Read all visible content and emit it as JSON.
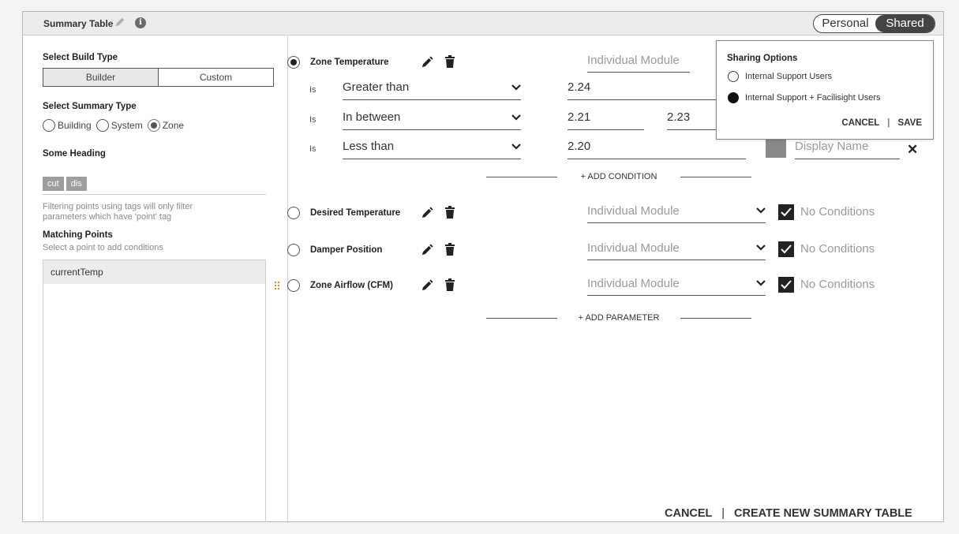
{
  "header": {
    "title": "Summary Table",
    "toggle": {
      "personal_label": "Personal",
      "shared_label": "Shared",
      "selected": "Shared"
    }
  },
  "left": {
    "build_type": {
      "label": "Select Build Type",
      "options": [
        "Builder",
        "Custom"
      ],
      "selected": "Builder"
    },
    "summary_type": {
      "label": "Select Summary Type",
      "options": [
        "Building",
        "System",
        "Zone"
      ],
      "selected": "Zone"
    },
    "heading": {
      "label": "Some Heading",
      "tags": [
        "cut",
        "dis"
      ]
    },
    "note": "Filtering points using tags will only filter parameters which have 'point' tag",
    "matching": {
      "label": "Matching Points",
      "hint": "Select a point to add conditions",
      "points": [
        "currentTemp"
      ]
    }
  },
  "parameters": [
    {
      "name": "Zone Temperature",
      "selected": true,
      "module": "Individual Module",
      "conditions": [
        {
          "is": "Is",
          "operator": "Greater than",
          "value": "2.24"
        },
        {
          "is": "Is",
          "operator": "In between",
          "value": "2.21",
          "value2": "2.23"
        },
        {
          "is": "Is",
          "operator": "Less than",
          "value": "2.20",
          "display_placeholder": "Display Name"
        }
      ]
    },
    {
      "name": "Desired Temperature",
      "selected": false,
      "module": "Individual Module",
      "no_conditions": "No Conditions"
    },
    {
      "name": "Damper Position",
      "selected": false,
      "module": "Individual Module",
      "no_conditions": "No Conditions"
    },
    {
      "name": "Zone Airflow (CFM)",
      "selected": false,
      "module": "Individual Module",
      "no_conditions": "No Conditions"
    }
  ],
  "add_condition": "+ ADD CONDITION",
  "add_parameter": "+ ADD PARAMETER",
  "sharing": {
    "title": "Sharing Options",
    "options": [
      "Internal Support Users",
      "Internal Support + Facilisight Users"
    ],
    "selected": "Internal Support + Facilisight Users",
    "cancel": "CANCEL",
    "save": "SAVE",
    "separator": "|"
  },
  "footer": {
    "cancel": "CANCEL",
    "separator": "|",
    "create": "CREATE NEW SUMMARY TABLE"
  }
}
